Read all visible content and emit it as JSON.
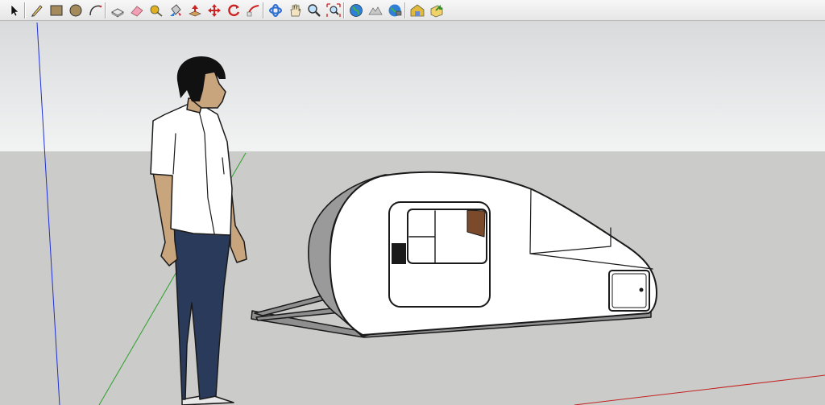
{
  "toolbar": {
    "tools": [
      {
        "id": "select",
        "icon": "arrow-cursor-icon"
      },
      {
        "id": "line",
        "icon": "pencil-icon"
      },
      {
        "id": "rectangle",
        "icon": "rectangle-icon"
      },
      {
        "id": "circle",
        "icon": "circle-icon"
      },
      {
        "id": "arc",
        "icon": "arc-icon"
      },
      {
        "id": "make-component",
        "icon": "component-icon"
      },
      {
        "id": "eraser",
        "icon": "eraser-icon"
      },
      {
        "id": "tape-measure",
        "icon": "tape-measure-icon"
      },
      {
        "id": "paint-bucket",
        "icon": "paint-bucket-icon"
      },
      {
        "id": "push-pull",
        "icon": "push-pull-icon"
      },
      {
        "id": "move",
        "icon": "move-icon"
      },
      {
        "id": "rotate",
        "icon": "rotate-icon"
      },
      {
        "id": "follow-me",
        "icon": "follow-me-icon"
      },
      {
        "id": "orbit",
        "icon": "orbit-icon"
      },
      {
        "id": "pan",
        "icon": "hand-icon"
      },
      {
        "id": "zoom",
        "icon": "magnifier-icon"
      },
      {
        "id": "zoom-extents",
        "icon": "zoom-extents-icon"
      },
      {
        "id": "get-location",
        "icon": "globe-icon"
      },
      {
        "id": "toggle-terrain",
        "icon": "terrain-icon"
      },
      {
        "id": "photo-textures",
        "icon": "earth-camera-icon"
      },
      {
        "id": "3d-warehouse",
        "icon": "warehouse-icon"
      },
      {
        "id": "extension-warehouse",
        "icon": "share-model-icon"
      }
    ]
  },
  "scene": {
    "colors": {
      "sky_top": "#d8dadc",
      "sky_bottom": "#f2f3f3",
      "ground": "#cbcbc9",
      "axis_blue": "#1f2fd6",
      "axis_green": "#2aa12a",
      "axis_red": "#c42222",
      "edges": "#1a1a1a",
      "shirt": "#ffffff",
      "jeans": "#2a3a5a",
      "skin": "#c9a57e",
      "hair": "#111111",
      "trailer_body": "#ffffff",
      "trailer_front": "#9a9a9a",
      "frame": "#8f8f8f",
      "wood": "#7a4a2a"
    }
  }
}
